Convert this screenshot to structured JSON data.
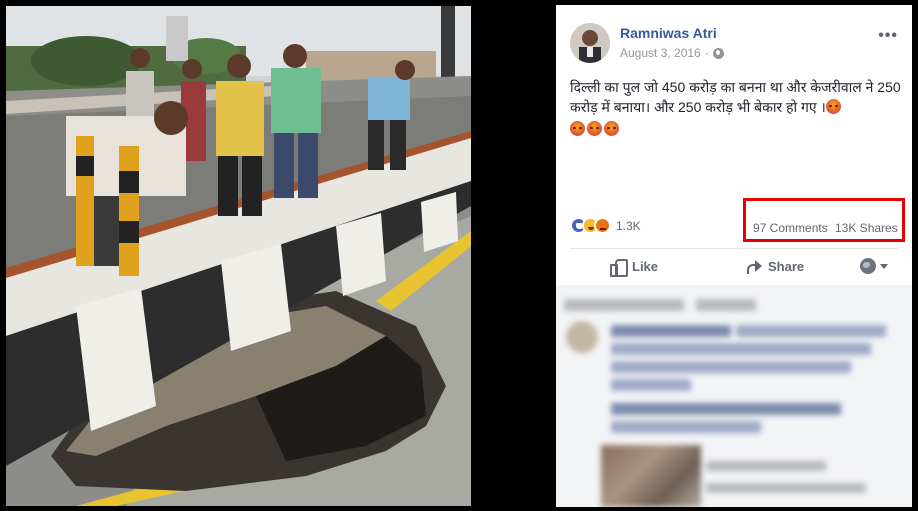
{
  "post": {
    "author": "Ramniwas Atri",
    "date": "August 3, 2016",
    "audience_icon": "globe-icon",
    "menu_label": "•••",
    "text": "दिल्ली का पुल जो 450 करोड़ का बनना था और केजरीवाल ने 250 करोड़ में बनाया। और 250 करोड़ भी बेकार हो गए ।",
    "reaction_count": "1.3K",
    "comments_label": "97 Comments",
    "shares_label": "13K Shares"
  },
  "actions": {
    "like_label": "Like",
    "share_label": "Share"
  },
  "colors": {
    "author_link": "#365899",
    "highlight_box": "#e60000",
    "meta_text": "#90949c"
  }
}
